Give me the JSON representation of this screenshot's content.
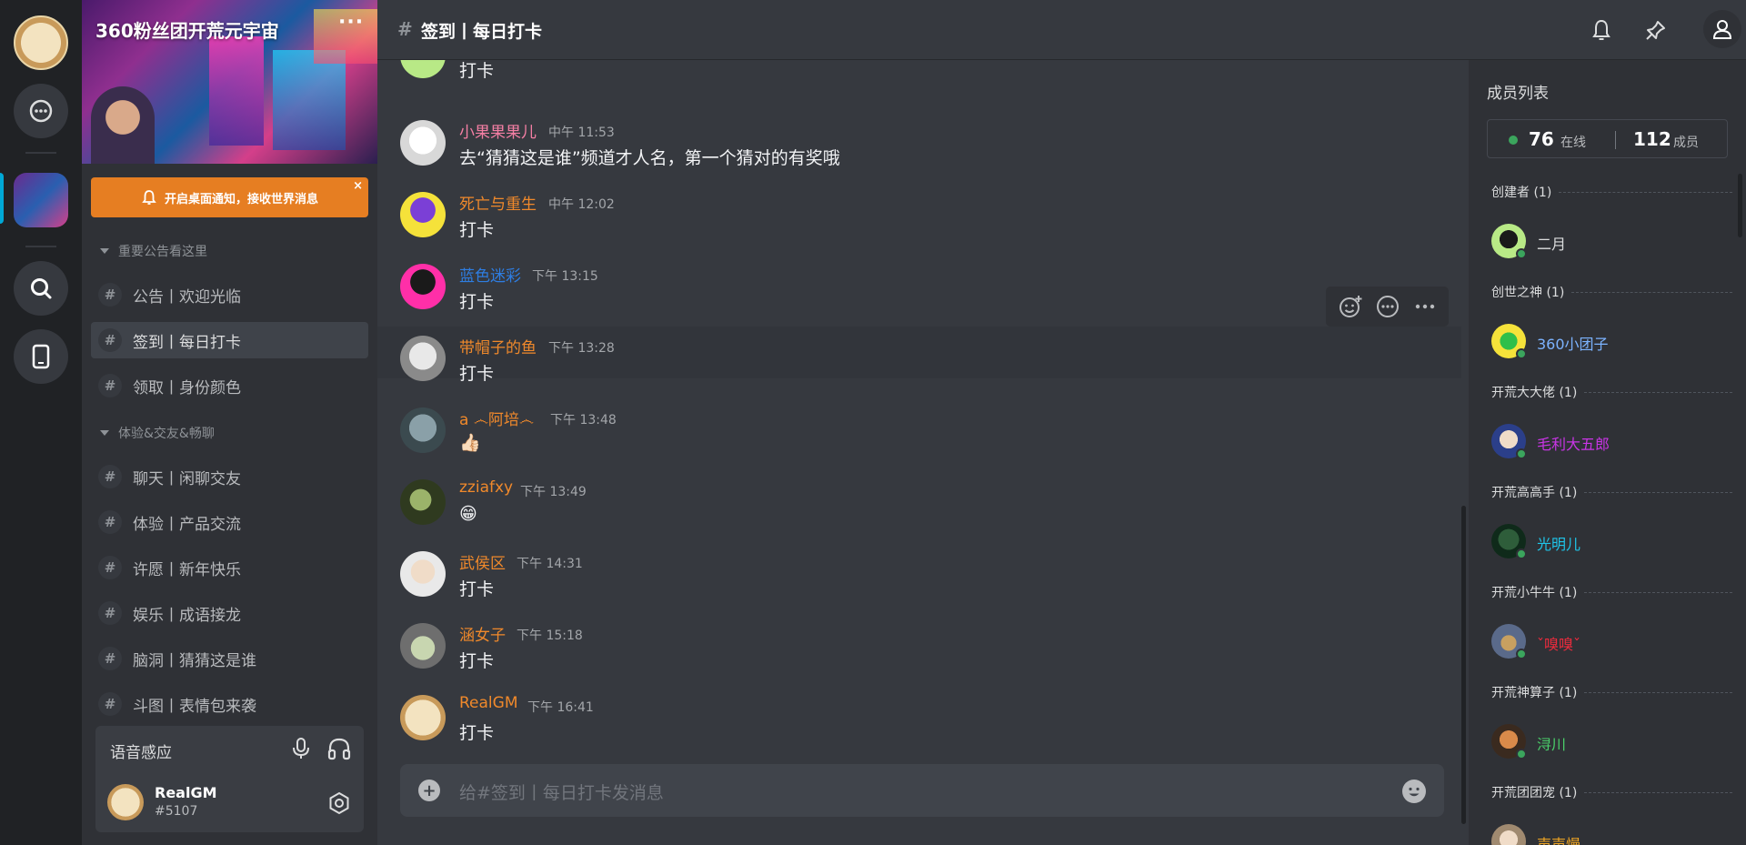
{
  "server": {
    "title": "360粉丝团开荒元宇宙",
    "menu_label": "···"
  },
  "notify": {
    "text": "开启桌面通知，接收世界消息",
    "close": "×"
  },
  "categories": [
    {
      "label": "重要公告看这里"
    },
    {
      "label": "体验&交友&畅聊"
    }
  ],
  "channels": [
    {
      "label": "公告丨欢迎光临"
    },
    {
      "label": "签到丨每日打卡"
    },
    {
      "label": "领取丨身份颜色"
    },
    {
      "label": "聊天丨闲聊交友"
    },
    {
      "label": "体验丨产品交流"
    },
    {
      "label": "许愿丨新年快乐"
    },
    {
      "label": "娱乐丨成语接龙"
    },
    {
      "label": "脑洞丨猜猜这是谁"
    },
    {
      "label": "斗图丨表情包来袭"
    }
  ],
  "hash_symbol": "#",
  "voice": {
    "title": "语音感应",
    "user_name": "RealGM",
    "user_tag": "#5107"
  },
  "header": {
    "channel_title": "签到丨每日打卡"
  },
  "messages": [
    {
      "name": "",
      "time": "",
      "text": "打卡",
      "color": "#ffffff"
    },
    {
      "name": "小果果果儿",
      "time": "中午 11:53",
      "text": "去“猜猜这是谁”频道才人名，第一个猜对的有奖哦",
      "color": "#f47fa4"
    },
    {
      "name": "死亡与重生",
      "time": "中午 12:02",
      "text": "打卡",
      "color": "#f0892b"
    },
    {
      "name": "蓝色迷彩",
      "time": "下午 13:15",
      "text": "打卡",
      "color": "#2e7de1"
    },
    {
      "name": "带帽子的鱼",
      "time": "下午 13:28",
      "text": "打卡",
      "color": "#f0892b"
    },
    {
      "name": "a ෴阿培෴",
      "time": "下午 13:48",
      "text": "👍🏻",
      "color": "#f0892b"
    },
    {
      "name": "zziafxy",
      "time": "下午 13:49",
      "text": "😁",
      "color": "#f0892b"
    },
    {
      "name": "武侯区",
      "time": "下午 14:31",
      "text": "打卡",
      "color": "#f0892b"
    },
    {
      "name": "涵女子",
      "time": "下午 15:18",
      "text": "打卡",
      "color": "#f0892b"
    },
    {
      "name": "RealGM",
      "time": "下午 16:41",
      "text": "打卡",
      "color": "#f0892b"
    }
  ],
  "composer": {
    "placeholder": "给#签到丨每日打卡发消息"
  },
  "members": {
    "title": "成员列表",
    "online_count": "76",
    "online_label": "在线",
    "total_count": "112",
    "total_label": "成员",
    "groups": [
      {
        "role": "创建者 (1)",
        "member": "二月",
        "color": "#dcddde"
      },
      {
        "role": "创世之神 (1)",
        "member": "360小团子",
        "color": "#7cb3ff"
      },
      {
        "role": "开荒大大佬 (1)",
        "member": "毛利大五郎",
        "color": "#c935e6"
      },
      {
        "role": "开荒高高手 (1)",
        "member": "光明儿",
        "color": "#1fc4e8"
      },
      {
        "role": "开荒小牛牛 (1)",
        "member": "ˇ嗅嗅ˇ",
        "color": "#ed2b3d"
      },
      {
        "role": "开荒神算子 (1)",
        "member": "浔川",
        "color": "#4ad06a"
      },
      {
        "role": "开荒团团宠 (1)",
        "member": "声声慢",
        "color": "#f0a623"
      }
    ]
  }
}
